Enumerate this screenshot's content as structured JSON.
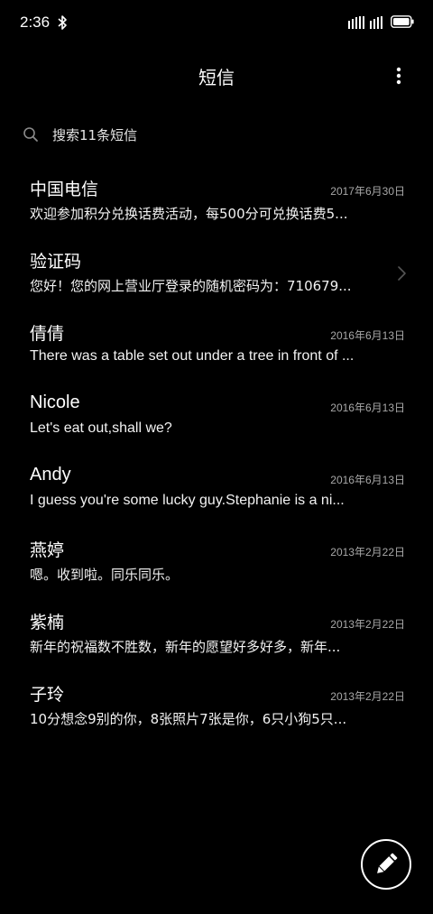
{
  "status_bar": {
    "time": "2:36",
    "icons": [
      "bluetooth-icon",
      "signal-icon",
      "signal-icon",
      "battery-icon"
    ]
  },
  "header": {
    "title": "短信",
    "menu_icon": "more-vertical-icon"
  },
  "search": {
    "placeholder": "搜索11条短信",
    "icon": "search-icon"
  },
  "messages": [
    {
      "sender": "中国电信",
      "date": "2017年6月30日",
      "preview": "欢迎参加积分兑换话费活动，每500分可兑换话费5..."
    },
    {
      "sender": "验证码",
      "date": "",
      "preview": "您好！您的网上营业厅登录的随机密码为：710679..."
    },
    {
      "sender": "倩倩",
      "date": "2016年6月13日",
      "preview": "There was a table set out under a tree in front of ..."
    },
    {
      "sender": "Nicole",
      "date": "2016年6月13日",
      "preview": "Let's eat out,shall we?"
    },
    {
      "sender": "Andy",
      "date": "2016年6月13日",
      "preview": "I guess you're some lucky guy.Stephanie is a ni..."
    },
    {
      "sender": "燕婷",
      "date": "2013年2月22日",
      "preview": "嗯。收到啦。同乐同乐。"
    },
    {
      "sender": "紫楠",
      "date": "2013年2月22日",
      "preview": "新年的祝福数不胜数，新年的愿望好多好多，新年..."
    },
    {
      "sender": "子玲",
      "date": "2013年2月22日",
      "preview": "10分想念9别的你，8张照片7张是你，6只小狗5只..."
    }
  ],
  "compose": {
    "icon": "pencil-icon"
  },
  "colors": {
    "background": "#000000",
    "text_primary": "#ffffff",
    "text_secondary": "#a8a8a8"
  }
}
